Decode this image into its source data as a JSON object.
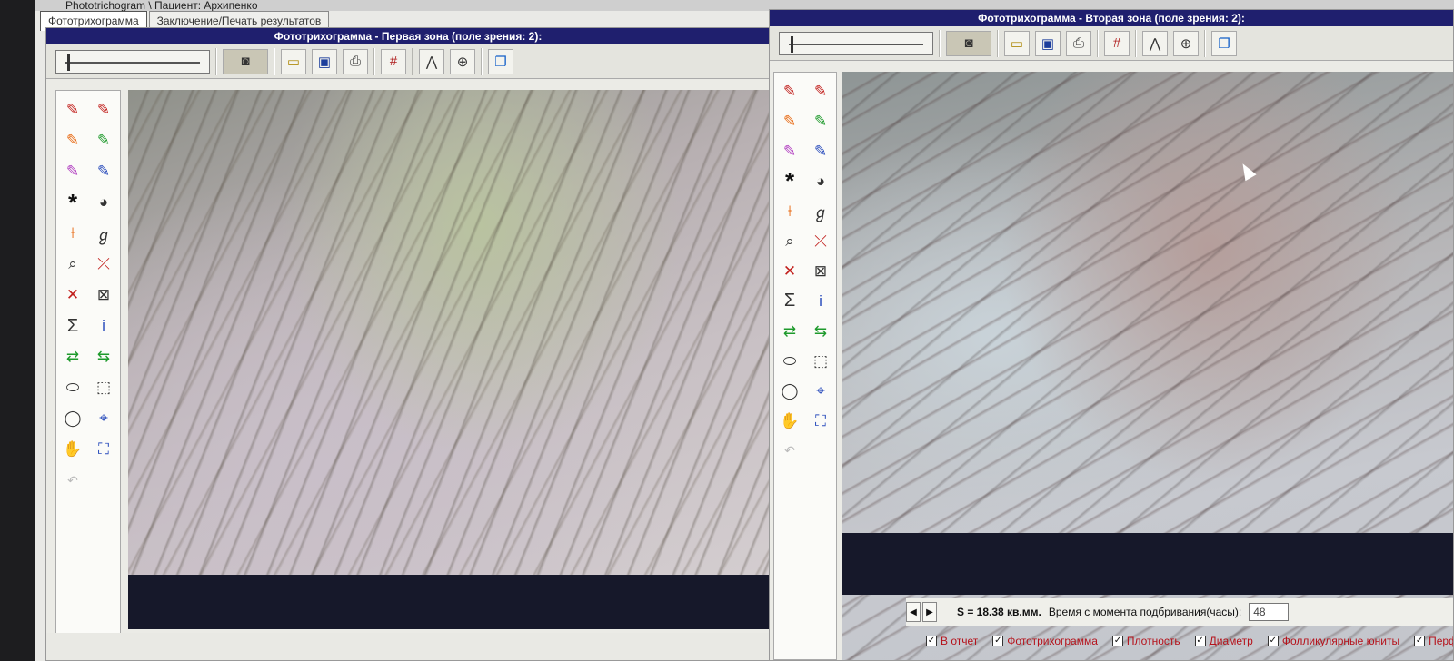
{
  "window": {
    "title": "Phototrichogram  \\  Пациент: Архипенко"
  },
  "tabs": [
    {
      "label": "Фототрихограмма"
    },
    {
      "label": "Заключение/Печать результатов"
    }
  ],
  "panel1": {
    "title": "Фототрихограмма - Первая зона (поле зрения: 2):"
  },
  "panel2": {
    "title": "Фототрихограмма - Вторая зона (поле зрения: 2):"
  },
  "toolbar": {
    "camera_icon": "camera-icon",
    "folder_icon": "folder-open-icon",
    "save_icon": "floppy-disk-icon",
    "print_icon": "printer-icon",
    "grid_icon": "grid-icon",
    "measure_icon": "angle-measure-icon",
    "target_icon": "crosshair-icon",
    "layers_icon": "layers-icon"
  },
  "status": {
    "area": "S = 18.38 кв.мм.",
    "time_label": "Время с момента подбривания(часы):",
    "hours_value": "48"
  },
  "checkboxes": [
    {
      "label": "В отчет",
      "checked": true
    },
    {
      "label": "Фототрихограмма",
      "checked": true
    },
    {
      "label": "Плотность",
      "checked": true
    },
    {
      "label": "Диаметр",
      "checked": true
    },
    {
      "label": "Фолликулярные юниты",
      "checked": true
    },
    {
      "label": "Перфолликулярные знаки",
      "checked": true
    }
  ],
  "colors": {
    "title_bar": "#1f1f6e",
    "checkbox_text": "#b5121b"
  }
}
